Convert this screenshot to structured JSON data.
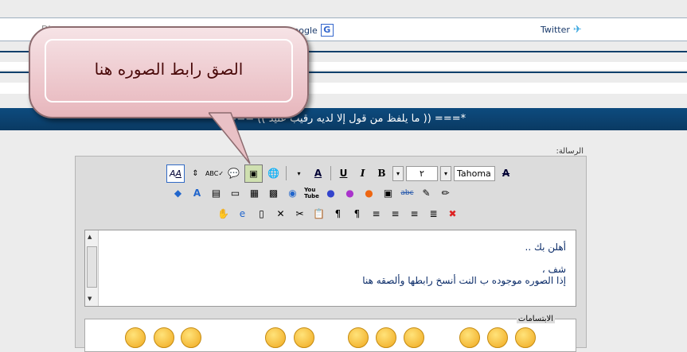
{
  "share": {
    "twitter": "Twitter",
    "google": "Google",
    "digg": "Digg"
  },
  "title_bar": "*=== (( ما يلفظ من قول إلا لديه رقيب عتيد )) ===*",
  "callout": "الصق رابط الصوره هنا",
  "message_label": "الرسالة:",
  "toolbar": {
    "font": "Tahoma",
    "size": "٢"
  },
  "editor_text": {
    "line1": "أهلن بك ..",
    "line2": "شف ،",
    "line3": "إذا الصوره موجوده ب النت أنسخ رابطها وألصقه هنا"
  },
  "smilies_label": "الابتسامات",
  "colors": {
    "title_bg": "#0d4b7e",
    "text": "#0a2b68",
    "accent_border": "#316ac5"
  }
}
